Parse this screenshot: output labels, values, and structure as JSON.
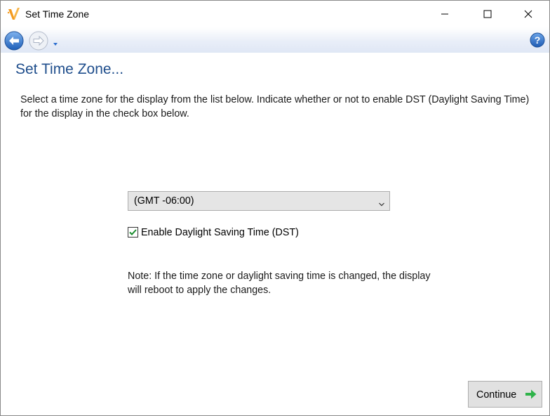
{
  "window": {
    "title": "Set Time Zone"
  },
  "page": {
    "heading": "Set Time Zone...",
    "instructions": "Select a time zone for the display from the list below. Indicate whether or not to enable DST (Daylight Saving Time) for the display in the check box below."
  },
  "timezone": {
    "selected": "(GMT -06:00)"
  },
  "dst": {
    "label": "Enable Daylight Saving Time (DST)",
    "checked": true
  },
  "note": "Note: If the time zone or daylight saving time is changed, the display will reboot to apply the changes.",
  "actions": {
    "continue_label": "Continue"
  },
  "colors": {
    "heading": "#1f4e8c",
    "nav_gradient_end": "#dfe7f5",
    "continue_arrow": "#2fb34a",
    "checkmark": "#1a8c2e"
  },
  "icons": {
    "app": "v-logo-icon",
    "back": "back-arrow-icon",
    "forward": "forward-arrow-icon",
    "help": "help-icon"
  }
}
